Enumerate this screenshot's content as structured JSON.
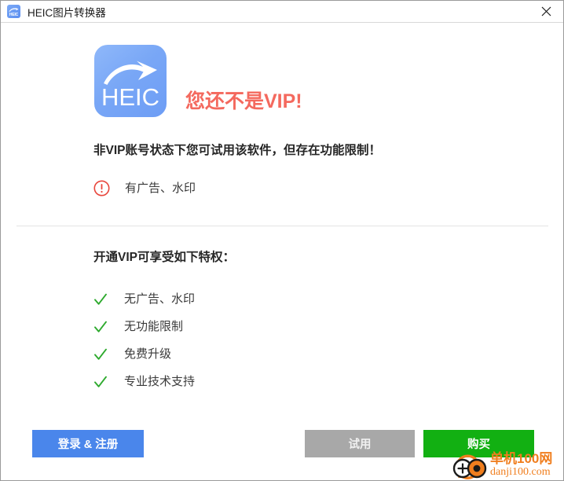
{
  "window": {
    "title": "HEIC图片转换器",
    "app_icon": "heic-app-icon",
    "app_icon_text": "HEIC",
    "close_icon": "close-icon"
  },
  "hero": {
    "logo_text": "HEIC",
    "logo_icon": "heic-logo-arrow-icon",
    "headline": "您还不是VIP!",
    "headline_color": "#f4695e"
  },
  "status": {
    "description": "非VIP账号状态下您可试用该软件，但存在功能限制！",
    "limitations": [
      {
        "icon": "exclamation-circle-icon",
        "label": "有广告、水印"
      }
    ]
  },
  "privileges": {
    "title": "开通VIP可享受如下特权：",
    "items": [
      {
        "icon": "check-icon",
        "label": "无广告、水印"
      },
      {
        "icon": "check-icon",
        "label": "无功能限制"
      },
      {
        "icon": "check-icon",
        "label": "免费升级"
      },
      {
        "icon": "check-icon",
        "label": "专业技术支持"
      }
    ]
  },
  "actions": {
    "login_register": "登录 & 注册",
    "trial": "试用",
    "buy": "购买",
    "login_color": "#4a86eb",
    "trial_color": "#a8a8a8",
    "buy_color": "#12b012"
  },
  "watermark": {
    "logo_icon": "danji100-logo-icon",
    "site_cn": "单机100网",
    "site_url": "danji100.com",
    "color": "#f07e1e"
  }
}
